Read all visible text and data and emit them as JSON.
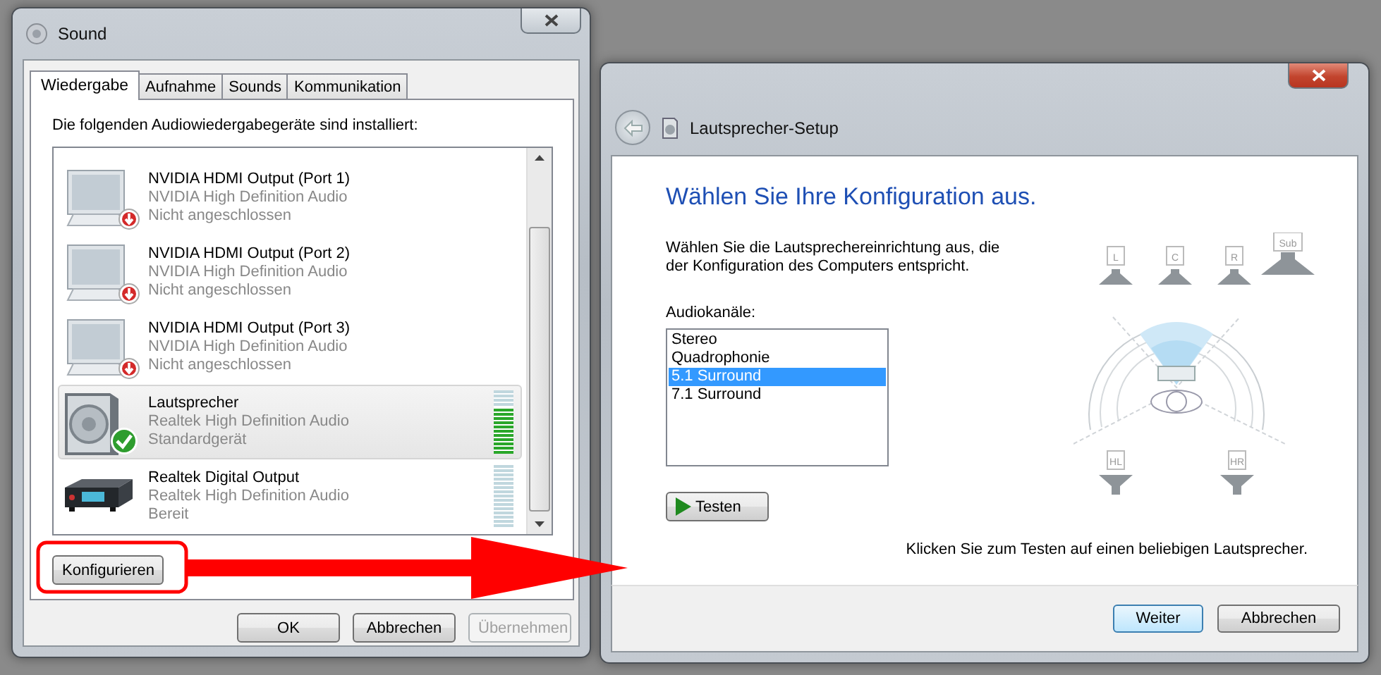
{
  "sound_window": {
    "title": "Sound",
    "tabs": [
      {
        "label": "Wiedergabe",
        "selected": true
      },
      {
        "label": "Aufnahme",
        "selected": false
      },
      {
        "label": "Sounds",
        "selected": false
      },
      {
        "label": "Kommunikation",
        "selected": false
      }
    ],
    "instruction": "Die folgenden Audiowiedergabegeräte sind installiert:",
    "devices": [
      {
        "name": "NVIDIA HDMI Output (Port 1)",
        "driver": "NVIDIA High Definition Audio",
        "status": "Nicht angeschlossen",
        "kind": "monitor",
        "unplugged": true,
        "default_device": false,
        "selected": false
      },
      {
        "name": "NVIDIA HDMI Output (Port 2)",
        "driver": "NVIDIA High Definition Audio",
        "status": "Nicht angeschlossen",
        "kind": "monitor",
        "unplugged": true,
        "default_device": false,
        "selected": false
      },
      {
        "name": "NVIDIA HDMI Output (Port 3)",
        "driver": "NVIDIA High Definition Audio",
        "status": "Nicht angeschlossen",
        "kind": "monitor",
        "unplugged": true,
        "default_device": false,
        "selected": false
      },
      {
        "name": "Lautsprecher",
        "driver": "Realtek High Definition Audio",
        "status": "Standardgerät",
        "kind": "speaker",
        "unplugged": false,
        "default_device": true,
        "selected": true,
        "level": 0.73
      },
      {
        "name": "Realtek Digital Output",
        "driver": "Realtek High Definition Audio",
        "status": "Bereit",
        "kind": "receiver",
        "unplugged": false,
        "default_device": false,
        "selected": false,
        "level": 0
      }
    ],
    "configure_button": "Konfigurieren",
    "buttons": [
      {
        "label": "OK",
        "disabled": false
      },
      {
        "label": "Abbrechen",
        "disabled": false
      },
      {
        "label": "Übernehmen",
        "disabled": true
      }
    ]
  },
  "setup_window": {
    "title": "Lautsprecher-Setup",
    "heading": "Wählen Sie Ihre Konfiguration aus.",
    "description_lines": [
      "Wählen Sie die Lautsprechereinrichtung aus, die",
      "der Konfiguration des Computers entspricht."
    ],
    "channels_label": "Audiokanäle:",
    "channels": [
      {
        "label": "Stereo",
        "selected": false
      },
      {
        "label": "Quadrophonie",
        "selected": false
      },
      {
        "label": "5.1 Surround",
        "selected": true
      },
      {
        "label": "7.1 Surround",
        "selected": false
      }
    ],
    "test_button": "Testen",
    "speakers": [
      {
        "label": "L"
      },
      {
        "label": "C"
      },
      {
        "label": "R"
      },
      {
        "label": "Sub"
      },
      {
        "label": "HL"
      },
      {
        "label": "HR"
      }
    ],
    "hint": "Klicken Sie zum Testen auf einen beliebigen Lautsprecher.",
    "buttons": [
      {
        "label": "Weiter",
        "default": true
      },
      {
        "label": "Abbrechen",
        "default": false
      }
    ]
  }
}
